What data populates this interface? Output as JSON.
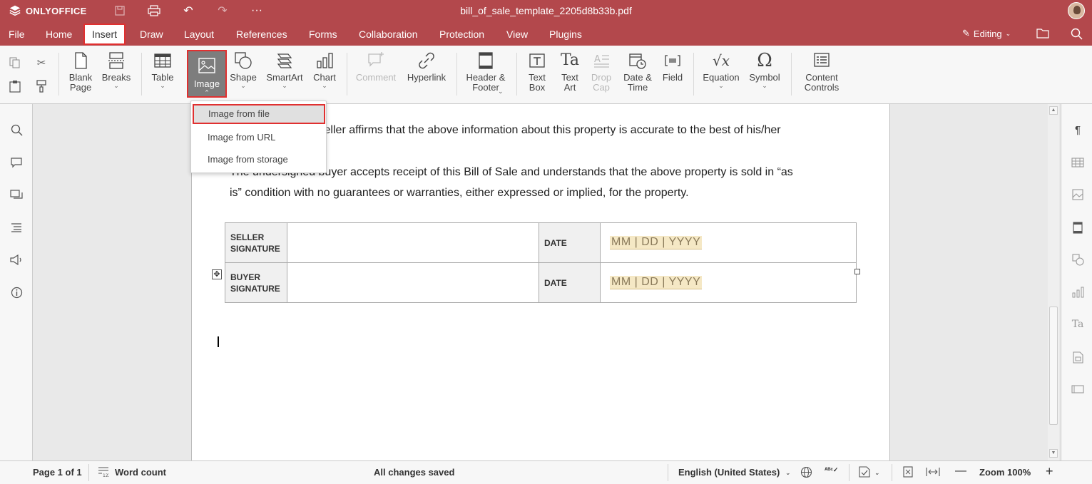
{
  "app": {
    "brand": "ONLYOFFICE",
    "doc_title": "bill_of_sale_template_2205d8b33b.pdf"
  },
  "menu": {
    "items": [
      "File",
      "Home",
      "Insert",
      "Draw",
      "Layout",
      "References",
      "Forms",
      "Collaboration",
      "Protection",
      "View",
      "Plugins"
    ],
    "active": "Insert",
    "editing_label": "Editing"
  },
  "toolbar": {
    "blank_page": "Blank Page",
    "breaks": "Breaks",
    "table": "Table",
    "image": "Image",
    "shape": "Shape",
    "smartart": "SmartArt",
    "chart": "Chart",
    "comment": "Comment",
    "hyperlink": "Hyperlink",
    "header_footer": "Header & Footer",
    "text_box": "Text Box",
    "text_art": "Text Art",
    "drop_cap": "Drop Cap",
    "date_time": "Date & Time",
    "field": "Field",
    "equation": "Equation",
    "symbol": "Symbol",
    "content_controls": "Content Controls"
  },
  "image_menu": {
    "items": [
      "Image from file",
      "Image from URL",
      "Image from storage"
    ],
    "selected": "Image from file"
  },
  "document": {
    "para1_line1": "The undersigned seller affirms that the above information about this property is accurate to the best of his/her",
    "para2_line1": "The undersigned buyer accepts receipt of this Bill of Sale and understands that the above property is sold in “as",
    "para2_line2": "is” condition with no guarantees or warranties, either expressed or implied, for the property.",
    "table": {
      "rows": [
        {
          "label_line1": "SELLER",
          "label_line2": "SIGNATURE",
          "date_label": "DATE",
          "date_placeholder": "MM | DD | YYYY"
        },
        {
          "label_line1": "BUYER",
          "label_line2": "SIGNATURE",
          "date_label": "DATE",
          "date_placeholder": "MM | DD | YYYY"
        }
      ]
    }
  },
  "status": {
    "page": "Page 1 of 1",
    "word_count": "Word count",
    "saved": "All changes saved",
    "language": "English (United States)",
    "zoom": "Zoom 100%"
  },
  "colors": {
    "accent": "#b3484c",
    "highlight_border": "#e03030"
  }
}
